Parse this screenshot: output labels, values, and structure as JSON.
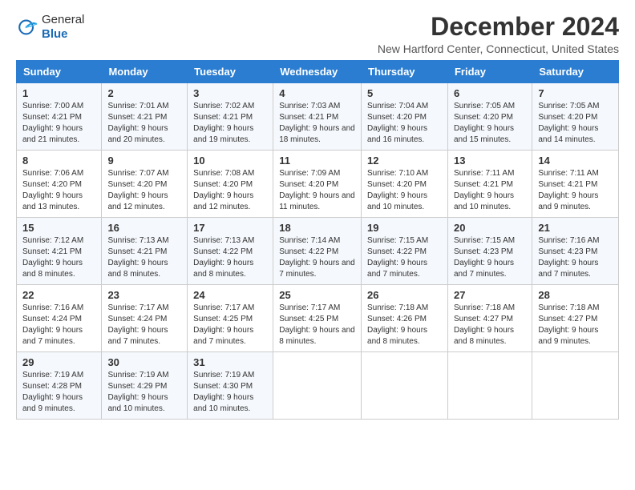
{
  "header": {
    "logo_line1": "General",
    "logo_line2": "Blue",
    "title": "December 2024",
    "location": "New Hartford Center, Connecticut, United States"
  },
  "days_of_week": [
    "Sunday",
    "Monday",
    "Tuesday",
    "Wednesday",
    "Thursday",
    "Friday",
    "Saturday"
  ],
  "weeks": [
    [
      {
        "day": "1",
        "sunrise": "7:00 AM",
        "sunset": "4:21 PM",
        "daylight": "9 hours and 21 minutes."
      },
      {
        "day": "2",
        "sunrise": "7:01 AM",
        "sunset": "4:21 PM",
        "daylight": "9 hours and 20 minutes."
      },
      {
        "day": "3",
        "sunrise": "7:02 AM",
        "sunset": "4:21 PM",
        "daylight": "9 hours and 19 minutes."
      },
      {
        "day": "4",
        "sunrise": "7:03 AM",
        "sunset": "4:21 PM",
        "daylight": "9 hours and 18 minutes."
      },
      {
        "day": "5",
        "sunrise": "7:04 AM",
        "sunset": "4:20 PM",
        "daylight": "9 hours and 16 minutes."
      },
      {
        "day": "6",
        "sunrise": "7:05 AM",
        "sunset": "4:20 PM",
        "daylight": "9 hours and 15 minutes."
      },
      {
        "day": "7",
        "sunrise": "7:05 AM",
        "sunset": "4:20 PM",
        "daylight": "9 hours and 14 minutes."
      }
    ],
    [
      {
        "day": "8",
        "sunrise": "7:06 AM",
        "sunset": "4:20 PM",
        "daylight": "9 hours and 13 minutes."
      },
      {
        "day": "9",
        "sunrise": "7:07 AM",
        "sunset": "4:20 PM",
        "daylight": "9 hours and 12 minutes."
      },
      {
        "day": "10",
        "sunrise": "7:08 AM",
        "sunset": "4:20 PM",
        "daylight": "9 hours and 12 minutes."
      },
      {
        "day": "11",
        "sunrise": "7:09 AM",
        "sunset": "4:20 PM",
        "daylight": "9 hours and 11 minutes."
      },
      {
        "day": "12",
        "sunrise": "7:10 AM",
        "sunset": "4:20 PM",
        "daylight": "9 hours and 10 minutes."
      },
      {
        "day": "13",
        "sunrise": "7:11 AM",
        "sunset": "4:21 PM",
        "daylight": "9 hours and 10 minutes."
      },
      {
        "day": "14",
        "sunrise": "7:11 AM",
        "sunset": "4:21 PM",
        "daylight": "9 hours and 9 minutes."
      }
    ],
    [
      {
        "day": "15",
        "sunrise": "7:12 AM",
        "sunset": "4:21 PM",
        "daylight": "9 hours and 8 minutes."
      },
      {
        "day": "16",
        "sunrise": "7:13 AM",
        "sunset": "4:21 PM",
        "daylight": "9 hours and 8 minutes."
      },
      {
        "day": "17",
        "sunrise": "7:13 AM",
        "sunset": "4:22 PM",
        "daylight": "9 hours and 8 minutes."
      },
      {
        "day": "18",
        "sunrise": "7:14 AM",
        "sunset": "4:22 PM",
        "daylight": "9 hours and 7 minutes."
      },
      {
        "day": "19",
        "sunrise": "7:15 AM",
        "sunset": "4:22 PM",
        "daylight": "9 hours and 7 minutes."
      },
      {
        "day": "20",
        "sunrise": "7:15 AM",
        "sunset": "4:23 PM",
        "daylight": "9 hours and 7 minutes."
      },
      {
        "day": "21",
        "sunrise": "7:16 AM",
        "sunset": "4:23 PM",
        "daylight": "9 hours and 7 minutes."
      }
    ],
    [
      {
        "day": "22",
        "sunrise": "7:16 AM",
        "sunset": "4:24 PM",
        "daylight": "9 hours and 7 minutes."
      },
      {
        "day": "23",
        "sunrise": "7:17 AM",
        "sunset": "4:24 PM",
        "daylight": "9 hours and 7 minutes."
      },
      {
        "day": "24",
        "sunrise": "7:17 AM",
        "sunset": "4:25 PM",
        "daylight": "9 hours and 7 minutes."
      },
      {
        "day": "25",
        "sunrise": "7:17 AM",
        "sunset": "4:25 PM",
        "daylight": "9 hours and 8 minutes."
      },
      {
        "day": "26",
        "sunrise": "7:18 AM",
        "sunset": "4:26 PM",
        "daylight": "9 hours and 8 minutes."
      },
      {
        "day": "27",
        "sunrise": "7:18 AM",
        "sunset": "4:27 PM",
        "daylight": "9 hours and 8 minutes."
      },
      {
        "day": "28",
        "sunrise": "7:18 AM",
        "sunset": "4:27 PM",
        "daylight": "9 hours and 9 minutes."
      }
    ],
    [
      {
        "day": "29",
        "sunrise": "7:19 AM",
        "sunset": "4:28 PM",
        "daylight": "9 hours and 9 minutes."
      },
      {
        "day": "30",
        "sunrise": "7:19 AM",
        "sunset": "4:29 PM",
        "daylight": "9 hours and 10 minutes."
      },
      {
        "day": "31",
        "sunrise": "7:19 AM",
        "sunset": "4:30 PM",
        "daylight": "9 hours and 10 minutes."
      },
      null,
      null,
      null,
      null
    ]
  ]
}
